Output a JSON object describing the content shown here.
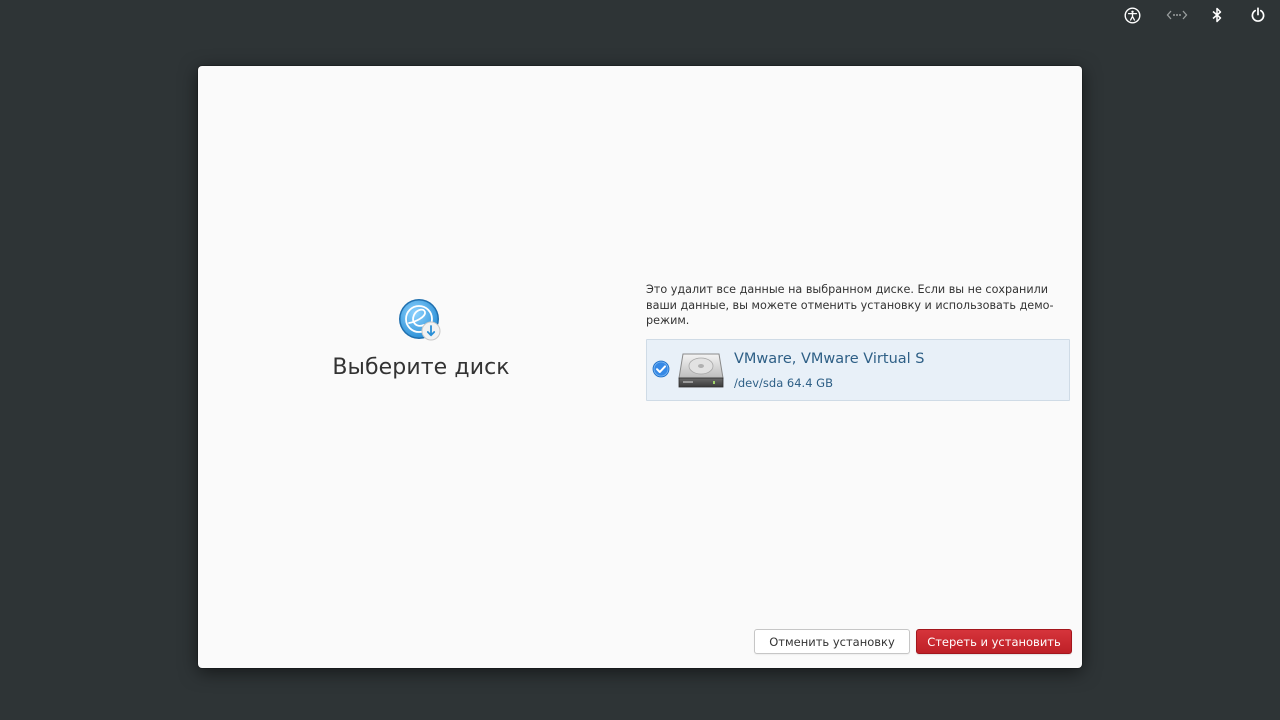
{
  "topbar": {
    "icons": [
      "accessibility-icon",
      "network-icon",
      "bluetooth-icon",
      "power-icon"
    ]
  },
  "page": {
    "title": "Выберите диск",
    "icon": "installer-icon"
  },
  "warning": {
    "text": "Это удалит все данные на выбранном диске. Если вы не сохранили ваши данные, вы можете отменить установку и использовать демо-режим."
  },
  "disks": [
    {
      "name": "VMware, VMware Virtual S",
      "details": "/dev/sda 64.4 GB",
      "selected": true
    }
  ],
  "buttons": {
    "cancel_label": "Отменить установку",
    "erase_label": "Стереть и установить"
  },
  "colors": {
    "background": "#2e3436",
    "window": "#fafafa",
    "selection": "#e8f0f8",
    "accent_text": "#2e5f86",
    "destructive": "#c6262e"
  }
}
